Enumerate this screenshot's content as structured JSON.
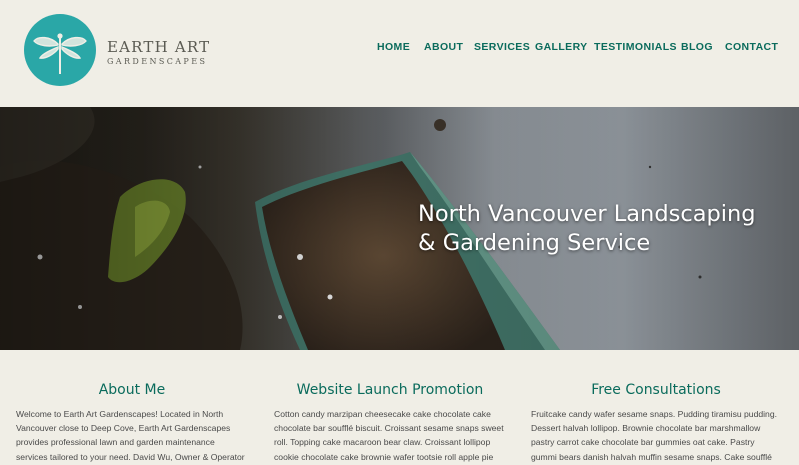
{
  "brand": {
    "title": "EARTH ART",
    "subtitle": "GARDENSCAPES",
    "logo_icon": "dragonfly-icon",
    "accent": "#2aa7a7"
  },
  "nav": {
    "items": [
      {
        "label": "HOME"
      },
      {
        "label": "ABOUT"
      },
      {
        "label": "SERVICES"
      },
      {
        "label": "GALLERY"
      },
      {
        "label": "TESTIMONIALS"
      },
      {
        "label": "BLOG"
      },
      {
        "label": "CONTACT"
      }
    ],
    "color": "#0a6b5c"
  },
  "hero": {
    "title_line1": "North Vancouver Landscaping",
    "title_line2": "& Gardening Service",
    "image_icon": "soil-trowel-photo"
  },
  "columns": [
    {
      "title": "About Me",
      "text": "Welcome to Earth Art Gardenscapes! Located in North Vancouver close to Deep Cove, Earth Art Gardenscapes provides professional lawn and garden maintenance services tailored to your need. David Wu, Owner & Operator of Earth Art Gardenscapes."
    },
    {
      "title": "Website Launch Promotion",
      "text": "Cotton candy marzipan cheesecake cake chocolate cake chocolate bar soufflé biscuit. Croissant sesame snaps sweet roll. Topping cake macaroon bear claw. Croissant lollipop cookie chocolate cake brownie wafer tootsie roll apple pie dessert."
    },
    {
      "title": "Free Consultations",
      "text": "Fruitcake candy wafer sesame snaps. Pudding tiramisu pudding. Dessert halvah lollipop. Brownie chocolate bar marshmallow pastry carrot cake chocolate bar gummies oat cake. Pastry gummi bears danish halvah muffin sesame snaps. Cake soufflé jelly beans chocolate cake."
    }
  ]
}
